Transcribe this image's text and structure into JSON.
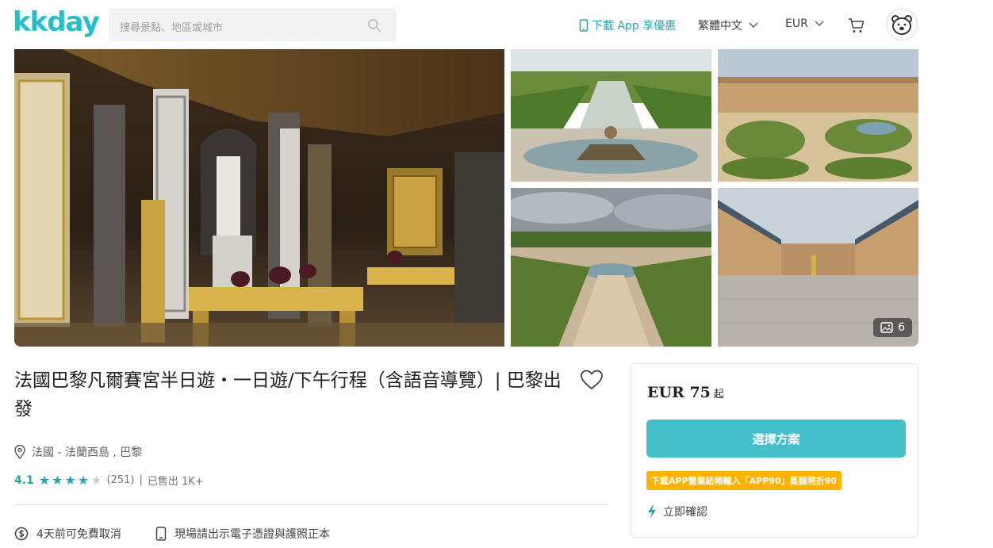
{
  "header": {
    "logo": "kkday",
    "search_placeholder": "搜尋景點、地區或城市",
    "app_promo": "下載 App 享優惠",
    "language": "繁體中文",
    "currency": "EUR"
  },
  "gallery": {
    "photo_count": "6"
  },
  "product": {
    "title": "法國巴黎凡爾賽宮半日遊・一日遊/下午行程（含語音導覽）| 巴黎出發",
    "location": "法國 - 法蘭西島 , 巴黎",
    "rating": "4.1",
    "stars_filled": 4,
    "stars_total": 5,
    "review_count": "(251)",
    "separator": "|",
    "sold": "已售出 1K+",
    "features": [
      {
        "label": "4天前可免費取消"
      },
      {
        "label": "現場請出示電子憑證與護照正本"
      }
    ]
  },
  "booking": {
    "price": "EUR 75",
    "price_suffix": "起",
    "select_label": "選擇方案",
    "promo": "下載APP營業結帳輸入「APP90」蒸額現折90",
    "instant": "立即確認"
  },
  "colors": {
    "brand": "#26bec9",
    "button": "#45bfc9",
    "promo": "#ffb300"
  }
}
